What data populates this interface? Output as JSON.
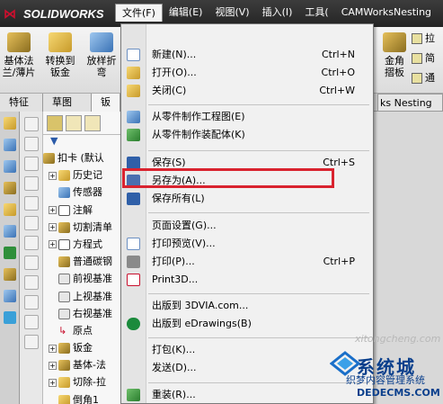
{
  "app": {
    "logo_text": "SOLIDWORKS"
  },
  "menubar": [
    {
      "label": "文件(F)"
    },
    {
      "label": "编辑(E)"
    },
    {
      "label": "视图(V)"
    },
    {
      "label": "插入(I)"
    },
    {
      "label": "工具("
    },
    {
      "label": "CAMWorksNesting"
    }
  ],
  "ribbon": {
    "buttons": [
      {
        "label": "基体法\n兰/薄片"
      },
      {
        "label": "转换到\n钣金"
      },
      {
        "label": "放样折\n弯"
      }
    ],
    "right_buttons": [
      {
        "label": "拉"
      },
      {
        "label": "简"
      },
      {
        "label": "通"
      }
    ],
    "right_big_label": "金角\n摺板"
  },
  "tabs": [
    {
      "label": "特征"
    },
    {
      "label": "草图"
    },
    {
      "label": "钣"
    }
  ],
  "cam_tab": "ks Nesting",
  "tree": {
    "items": [
      {
        "label": "扣卡 (默认",
        "expander": ""
      },
      {
        "label": "历史记",
        "expander": "+"
      },
      {
        "label": "传感器",
        "expander": ""
      },
      {
        "label": "注解",
        "expander": "+"
      },
      {
        "label": "切割清单",
        "expander": "+"
      },
      {
        "label": "方程式",
        "expander": "+"
      },
      {
        "label": "普通碳钢",
        "expander": ""
      },
      {
        "label": "前视基准",
        "expander": ""
      },
      {
        "label": "上视基准",
        "expander": ""
      },
      {
        "label": "右视基准",
        "expander": ""
      },
      {
        "label": "原点",
        "expander": ""
      },
      {
        "label": "钣金",
        "expander": "+"
      },
      {
        "label": "基体-法",
        "expander": "+"
      },
      {
        "label": "切除-拉",
        "expander": "+"
      },
      {
        "label": "倒角1",
        "expander": ""
      }
    ]
  },
  "file_menu": {
    "items": [
      {
        "label": "新建(N)...",
        "shortcut": "Ctrl+N"
      },
      {
        "label": "打开(O)...",
        "shortcut": "Ctrl+O"
      },
      {
        "label": "关闭(C)",
        "shortcut": "Ctrl+W"
      },
      {
        "label": "从零件制作工程图(E)",
        "shortcut": ""
      },
      {
        "label": "从零件制作装配体(K)",
        "shortcut": ""
      },
      {
        "label": "保存(S)",
        "shortcut": "Ctrl+S"
      },
      {
        "label": "另存为(A)...",
        "shortcut": ""
      },
      {
        "label": "保存所有(L)",
        "shortcut": ""
      },
      {
        "label": "页面设置(G)...",
        "shortcut": ""
      },
      {
        "label": "打印预览(V)...",
        "shortcut": ""
      },
      {
        "label": "打印(P)...",
        "shortcut": "Ctrl+P"
      },
      {
        "label": "Print3D...",
        "shortcut": ""
      },
      {
        "label": "出版到 3DVIA.com...",
        "shortcut": ""
      },
      {
        "label": "出版到 eDrawings(B)",
        "shortcut": ""
      },
      {
        "label": "打包(K)...",
        "shortcut": ""
      },
      {
        "label": "发送(D)...",
        "shortcut": ""
      },
      {
        "label": "重装(R)...",
        "shortcut": ""
      }
    ]
  },
  "watermark": {
    "line1": "系统城",
    "line2": "织梦内容管理系统",
    "line3": "DEDECMS.COM",
    "faint": "xitongcheng.com"
  },
  "colors": {
    "highlight": "#d9232f",
    "titlebar": "#2e2e2e",
    "watermark": "#0a3f8c"
  }
}
